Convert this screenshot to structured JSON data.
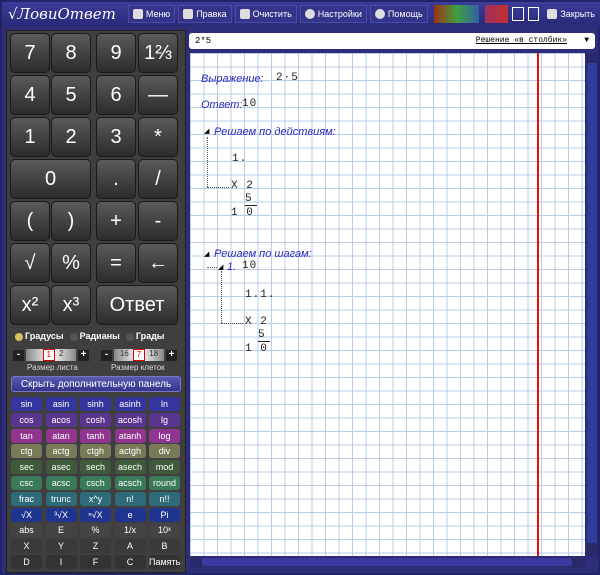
{
  "titlebar": {
    "logo": "√ЛовиОтвет",
    "menu": "Меню",
    "help": "Правка",
    "clear": "Очистить",
    "settings": "Настройки",
    "assist": "Помощь",
    "close": "Закрыть"
  },
  "keypad": [
    "7",
    "8",
    "9",
    "1⅔",
    "4",
    "5",
    "6",
    "—",
    "1",
    "2",
    "3",
    "*",
    "0",
    ".",
    "/",
    "(",
    ")",
    "+",
    "-",
    "√",
    "%",
    "=",
    "←",
    "x²",
    "x³",
    "Ответ"
  ],
  "angle": {
    "deg": "Градусы",
    "rad": "Радианы",
    "grad": "Грады",
    "selected": "deg"
  },
  "sheet": {
    "prev": "",
    "value": "1",
    "next": "2",
    "label": "Размер листа"
  },
  "cell": {
    "prev": "16",
    "value": "7",
    "next": "18",
    "label": "Размер клеток"
  },
  "hide_panel": "Скрыть дополнительную панель",
  "funcs": [
    [
      "sin",
      "asin",
      "sinh",
      "asinh",
      "ln"
    ],
    [
      "cos",
      "acos",
      "cosh",
      "acosh",
      "lg"
    ],
    [
      "tan",
      "atan",
      "tanh",
      "atanh",
      "log"
    ],
    [
      "ctg",
      "actg",
      "ctgh",
      "actgh",
      "div"
    ],
    [
      "sec",
      "asec",
      "sech",
      "asech",
      "mod"
    ],
    [
      "csc",
      "acsc",
      "csch",
      "acsch",
      "round"
    ],
    [
      "frac",
      "trunc",
      "x^y",
      "n!",
      "n!!"
    ],
    [
      "√X",
      "³√X",
      "ⁿ√X",
      "e",
      "Pi"
    ],
    [
      "abs",
      "E",
      "%",
      "1/x",
      "10ˣ"
    ],
    [
      "X",
      "Y",
      "Z",
      "A",
      "B"
    ],
    [
      "D",
      "I",
      "F",
      "C",
      "Память"
    ]
  ],
  "func_colors": [
    "#3535a0",
    "#5a3590",
    "#903590",
    "#7a7a58",
    "#3f5a3a",
    "#3a7a5a",
    "#2f6a78",
    "#1f3590",
    "#444444",
    "#3a3a3a",
    "#333333"
  ],
  "expression_input": "2*5",
  "mode": "Решение «в столбик»",
  "solution": {
    "expr_label": "Выражение:",
    "expr": "2·5",
    "ans_label": "Ответ:",
    "ans": "10",
    "actions_label": "Решаем по действиям:",
    "step1": "1.",
    "m1": "X 2",
    "m2": "5",
    "r": "1 0",
    "steps_label": "Решаем по шагам:",
    "s1": "1.",
    "s1val": "10",
    "s11": "1.1.",
    "sm1": "X 2",
    "sm2": "5",
    "sr": "1 0"
  }
}
